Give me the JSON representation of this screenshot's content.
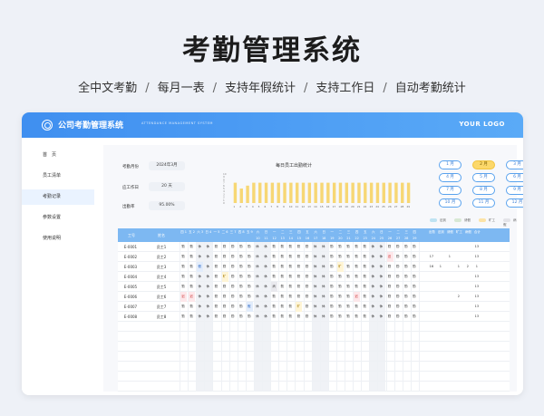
{
  "hero": {
    "title": "考勤管理系统",
    "features": [
      "全中文考勤",
      "每月一表",
      "支持年假统计",
      "支持工作日",
      "自动考勤统计"
    ],
    "separator": "/"
  },
  "app": {
    "title": "公司考勤管理系统",
    "subtitle": "ATTENDANCE MANAGEMENT SYSTEM",
    "logo": "YOUR LOGO"
  },
  "sidebar": {
    "items": [
      {
        "label": "首　页",
        "active": false
      },
      {
        "label": "员工清单",
        "active": false
      },
      {
        "label": "考勤记录",
        "active": true
      },
      {
        "label": "参数设置",
        "active": false
      },
      {
        "label": "使用说明",
        "active": false
      }
    ]
  },
  "info": {
    "month_label": "考勤月份",
    "month_value": "2024年3月",
    "days_label": "应工作日",
    "days_value": "20 天",
    "rate_label": "出勤率",
    "rate_value": "95.00%"
  },
  "chart_data": {
    "type": "bar",
    "title": "每日员工出勤统计",
    "categories": [
      "1",
      "2",
      "3",
      "4",
      "5",
      "6",
      "7",
      "8",
      "9",
      "10",
      "11",
      "12",
      "13",
      "14",
      "15",
      "16",
      "17",
      "18",
      "19",
      "20",
      "21",
      "22",
      "23",
      "24",
      "25",
      "26",
      "27",
      "28",
      "29"
    ],
    "values": [
      7,
      5,
      6,
      7,
      7,
      7,
      7,
      7,
      7,
      7,
      7,
      7,
      7,
      7,
      7,
      7,
      7,
      7,
      7,
      7,
      7,
      7,
      7,
      7,
      7,
      7,
      7,
      7,
      7
    ],
    "ylim": [
      0,
      10
    ],
    "yticks": [
      "10",
      "9",
      "8",
      "7",
      "6",
      "5",
      "4",
      "3",
      "2",
      "1",
      "0"
    ],
    "color": "#f7d774"
  },
  "months": {
    "items": [
      "1 月",
      "2 月",
      "3 月",
      "4 月",
      "5 月",
      "6 月",
      "7 月",
      "8 月",
      "9 月",
      "10 月",
      "11 月",
      "12 月"
    ],
    "selected_index": 1
  },
  "legend": {
    "items": [
      {
        "label": "迟到",
        "color": "#bfe3f2"
      },
      {
        "label": "请假",
        "color": "#d8e8d4"
      },
      {
        "label": "旷工",
        "color": "#fce3a6"
      },
      {
        "label": "病假",
        "color": "#e3e3e8"
      }
    ]
  },
  "table": {
    "code_header": "工号",
    "name_header": "姓名",
    "day_weeks": [
      "四",
      "五",
      "六",
      "日",
      "一",
      "二",
      "三",
      "四",
      "五",
      "六",
      "日",
      "一",
      "二",
      "三",
      "四",
      "五",
      "六",
      "日",
      "一",
      "二",
      "三",
      "四",
      "五",
      "六",
      "日",
      "一",
      "二",
      "三",
      "四"
    ],
    "day_nums": [
      "1",
      "2",
      "3",
      "4",
      "5",
      "6",
      "7",
      "8",
      "9",
      "10",
      "11",
      "12",
      "13",
      "14",
      "15",
      "16",
      "17",
      "18",
      "19",
      "20",
      "21",
      "22",
      "23",
      "24",
      "25",
      "26",
      "27",
      "28",
      "29"
    ],
    "summary_headers": [
      "出勤",
      "迟到",
      "请假",
      "旷工",
      "病假",
      "合计"
    ],
    "rows": [
      {
        "code": "E-0001",
        "name": "员工1",
        "marks": {},
        "summary": [
          "",
          "",
          "",
          "",
          "",
          "13"
        ]
      },
      {
        "code": "E-0002",
        "name": "员工2",
        "marks": {
          "25": "late"
        },
        "summary": [
          "17",
          "",
          "1",
          "",
          "",
          "13"
        ]
      },
      {
        "code": "E-0003",
        "name": "员工3",
        "marks": {
          "2": "leave",
          "19": "out"
        },
        "summary": [
          "16",
          "1",
          "",
          "1",
          "2",
          "1"
        ]
      },
      {
        "code": "E-0004",
        "name": "员工4",
        "marks": {
          "5": "out"
        },
        "summary": [
          "",
          "",
          "",
          "",
          "",
          "13"
        ]
      },
      {
        "code": "E-0005",
        "name": "员工5",
        "marks": {
          "11": "sick"
        },
        "summary": [
          "",
          "",
          "",
          "",
          "",
          "13"
        ]
      },
      {
        "code": "E-0006",
        "name": "员工6",
        "marks": {
          "0": "late",
          "1": "late",
          "21": "late"
        },
        "summary": [
          "",
          "",
          "",
          "2",
          "",
          "13"
        ]
      },
      {
        "code": "E-0007",
        "name": "员工7",
        "marks": {
          "8": "leave",
          "14": "out"
        },
        "summary": [
          "",
          "",
          "",
          "",
          "",
          "13"
        ]
      },
      {
        "code": "E-0008",
        "name": "员工8",
        "marks": {},
        "summary": [
          "",
          "",
          "",
          "",
          "",
          "13"
        ]
      }
    ],
    "present_mark": "勤",
    "weekend_mark": "休",
    "late_mark": "迟",
    "leave_mark": "假",
    "out_mark": "旷",
    "sick_mark": "病"
  }
}
